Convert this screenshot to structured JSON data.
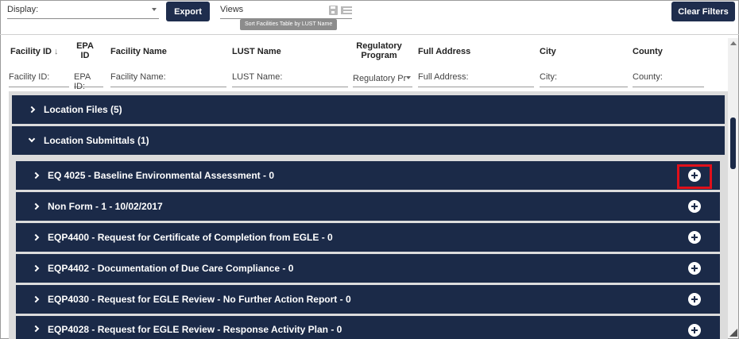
{
  "toolbar": {
    "display_label": "Display:",
    "export_label": "Export",
    "views_label": "Views",
    "tooltip": "Sort Facilities Table by LUST Name",
    "clear_filters_label": "Clear Filters",
    "save_icon": "save-icon",
    "list_icon": "list-icon"
  },
  "columns": [
    {
      "label": "Facility ID",
      "filter": "Facility ID:"
    },
    {
      "label": "EPA ID",
      "filter": "EPA ID:"
    },
    {
      "label": "Facility Name",
      "filter": "Facility Name:"
    },
    {
      "label": "LUST Name",
      "filter": "LUST Name:"
    },
    {
      "label": "Regulatory Program",
      "filter": "Regulatory Pr"
    },
    {
      "label": "Full Address",
      "filter": "Full Address:"
    },
    {
      "label": "City",
      "filter": "City:"
    },
    {
      "label": "County",
      "filter": "County:"
    }
  ],
  "sections": {
    "location_files": "Location Files (5)",
    "location_submittals": "Location Submittals (1)"
  },
  "submittals": [
    "EQ 4025 - Baseline Environmental Assessment - 0",
    "Non Form - 1 - 10/02/2017",
    "EQP4400 - Request for Certificate of Completion from EGLE - 0",
    "EQP4402 - Documentation of Due Care Compliance - 0",
    "EQP4030 - Request for EGLE Review - No Further Action Report - 0",
    "EQP4028 - Request for EGLE Review - Response Activity Plan - 0"
  ],
  "colors": {
    "navy": "#1b2a48",
    "highlight": "#e0101a"
  }
}
